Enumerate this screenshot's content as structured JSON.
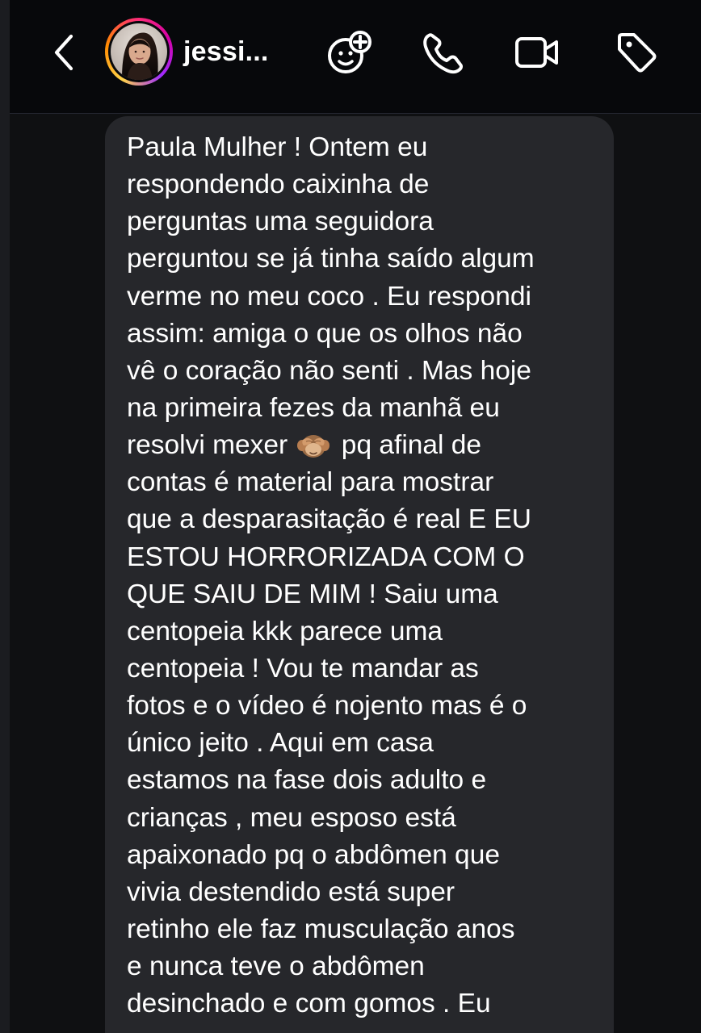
{
  "header": {
    "username": "jessi...",
    "back_icon": "chevron-left-icon",
    "effects_icon": "sticker-effects-icon",
    "call_icon": "phone-icon",
    "video_icon": "video-camera-icon",
    "tag_icon": "tag-icon"
  },
  "message": {
    "lines": [
      "Paula Mulher ! Ontem eu",
      "respondendo caixinha de",
      "perguntas uma seguidora",
      "perguntou se já tinha saído algum",
      "verme no meu coco . Eu respondi",
      "assim: amiga o que os olhos não",
      "vê o coração não senti . Mas hoje",
      "na primeira fezes da manhã eu",
      {
        "before": "resolvi mexer ",
        "emoji": "see-no-evil-monkey-icon",
        "after": " pq afinal de"
      },
      "contas é material para mostrar",
      "que a desparasitação é real E EU",
      "ESTOU HORRORIZADA COM O",
      "QUE SAIU DE MIM ! Saiu uma",
      "centopeia kkk parece uma",
      "centopeia ! Vou te mandar as",
      "fotos e o vídeo é nojento mas é o",
      "único jeito . Aqui em casa",
      "estamos na fase dois adulto e",
      "crianças , meu esposo está",
      "apaixonado pq o abdômen que",
      "vivia destendido está super",
      "retinho ele faz musculação anos",
      "e nunca teve o abdômen",
      "desinchado e com gomos . Eu"
    ]
  },
  "colors": {
    "header_background": "#07080b",
    "bubble_background": "#26272b",
    "text": "#ffffff",
    "story_ring": [
      "#ffd34a",
      "#ff8a00",
      "#ff2f73",
      "#d600a8",
      "#9f2cff"
    ]
  }
}
